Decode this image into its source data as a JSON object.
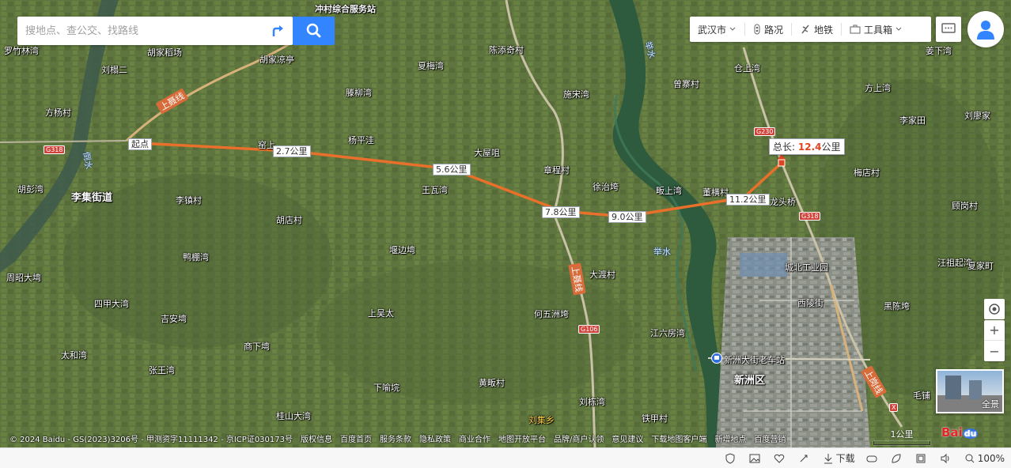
{
  "search": {
    "placeholder": "搜地点、查公交、找路线"
  },
  "toolbar": {
    "city": "武汉市",
    "traffic": "路况",
    "subway": "地铁",
    "toolbox": "工具箱"
  },
  "route": {
    "start_label": "起点",
    "segments": [
      "2.7公里",
      "5.6公里",
      "7.8公里",
      "9.0公里",
      "11.2公里"
    ],
    "total_prefix": "总长:",
    "total_value": "12.4",
    "total_unit": "公里"
  },
  "places": [
    "罗竹林湾",
    "胡家稻场",
    "胡家凉亭",
    "刘榻二",
    "方杨村",
    "胡彭湾",
    "李集街道",
    "李镇村",
    "胡店村",
    "鸭棚湾",
    "周昭大塆",
    "四甲大湾",
    "吉安塆",
    "太和湾",
    "张王湾",
    "商下塆",
    "上吴太",
    "下喻垸",
    "桂山大湾",
    "窑上",
    "杨平洼",
    "滕柳湾",
    "夏梅湾",
    "陈添奇村",
    "施宋湾",
    "大屋咀",
    "章程村",
    "王瓦湾",
    "堰边塆",
    "徐治垮",
    "大渡村",
    "何五洲垮",
    "黄畈村",
    "刘集乡",
    "刘栋湾",
    "江六房湾",
    "铁甲村",
    "曾寨村",
    "仓上湾",
    "畈上湾",
    "董横村",
    "龙头桥",
    "城北工业园",
    "西陵街",
    "新洲区",
    "李家田",
    "梅店村",
    "顾岗村",
    "汪祖起湾",
    "黑陈垮",
    "毛铺",
    "方上湾",
    "姜下湾",
    "刘廖家",
    "夏家町",
    "新洲大街老车站"
  ],
  "water": [
    "举水",
    "举水",
    "举水",
    "倒水"
  ],
  "roads": [
    "上聂线",
    "上聂线",
    "上岗线"
  ],
  "shields": [
    "G318",
    "G230",
    "G318",
    "G106",
    "X"
  ],
  "top_poi": "冲村综合服务站",
  "controls": {
    "panorama": "全景",
    "scale": "1公里",
    "logo": "Bai",
    "logo_du": "du"
  },
  "copyright": [
    "© 2024 Baidu - GS(2023)3206号 - 甲测资字11111342 - 京ICP证030173号",
    "版权信息",
    "百度首页",
    "服务条款",
    "隐私政策",
    "商业合作",
    "地图开放平台",
    "品牌/商户认领",
    "意见建议",
    "下载地图客户端",
    "新增地点",
    "百度营销"
  ],
  "statusbar": {
    "download": "下载",
    "zoom": "100%"
  },
  "colors": {
    "route": "#e8702a",
    "accent": "#3385ff",
    "total": "#e0441e"
  }
}
